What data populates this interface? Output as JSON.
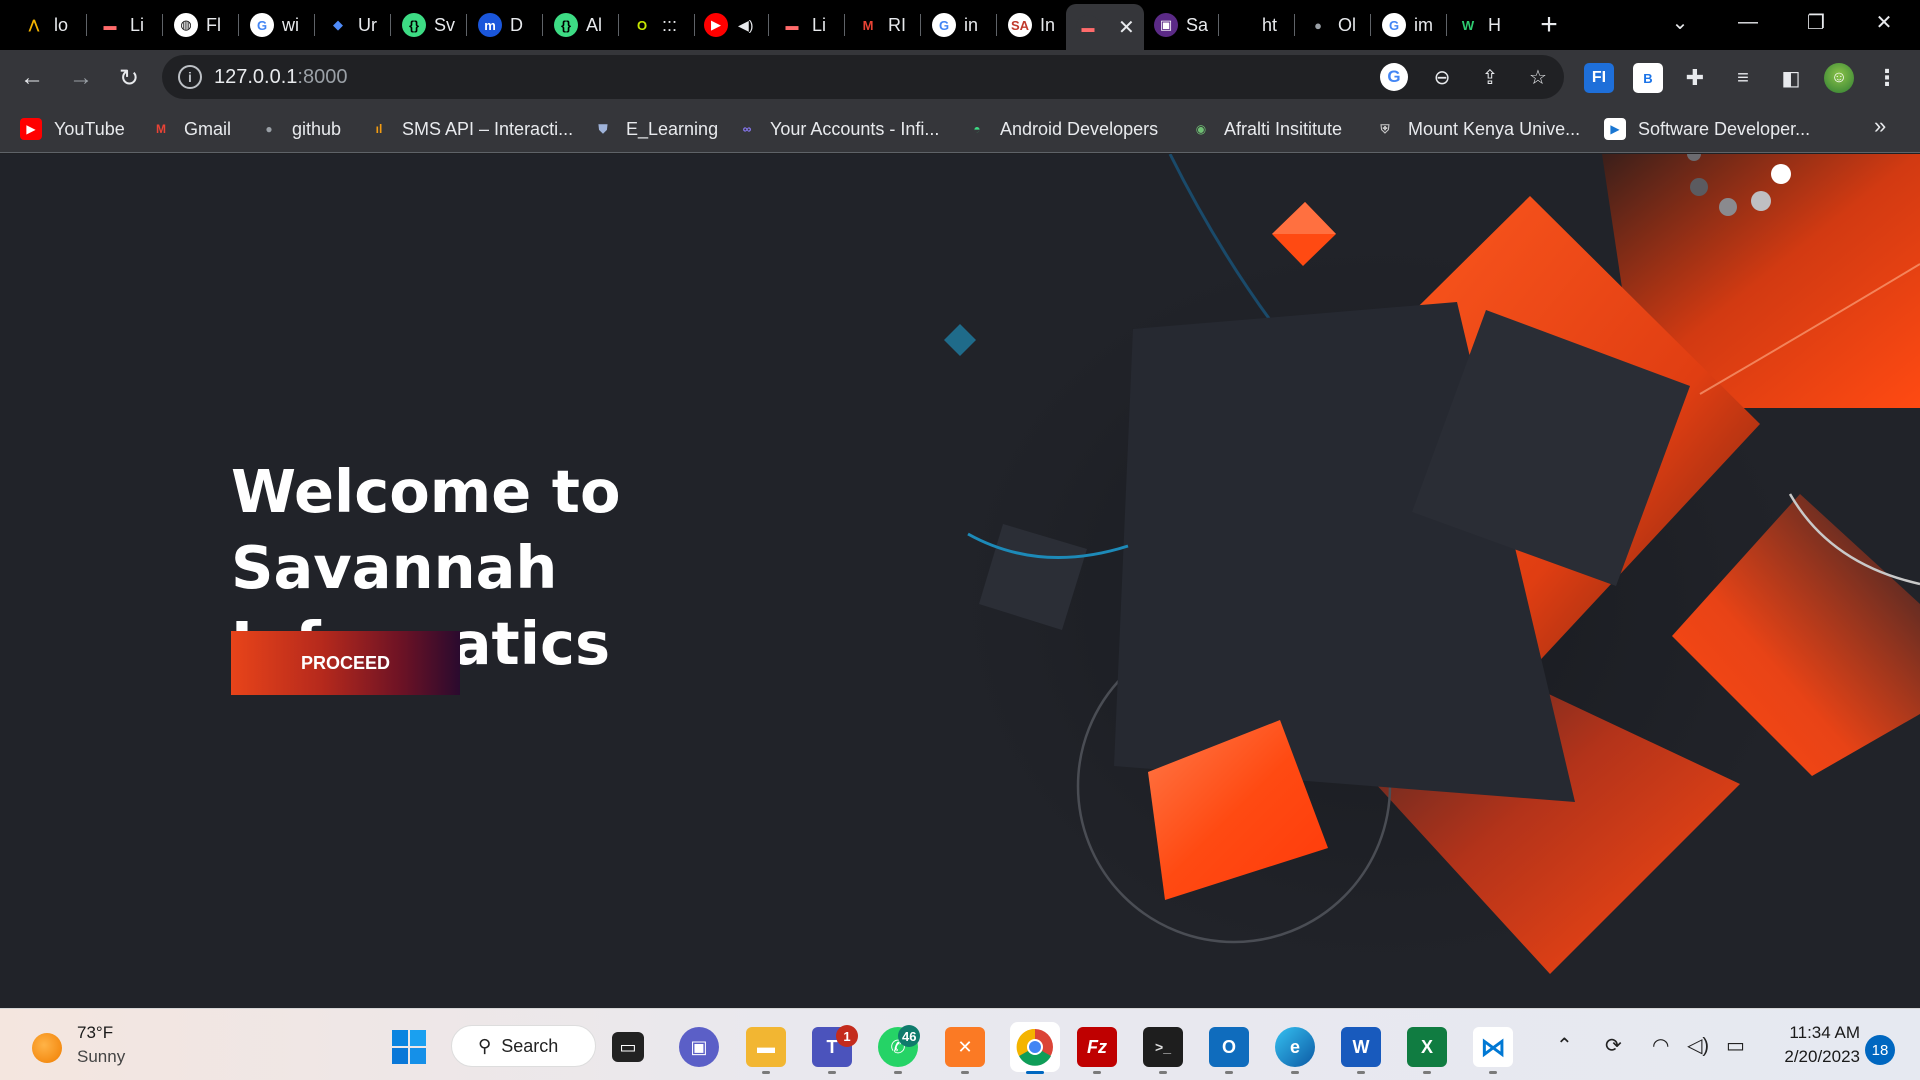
{
  "tabs": [
    {
      "title": "lo",
      "icon": "archway-logo-icon",
      "fav_bg": "#000000",
      "fav_fg": "#f4b400",
      "fav_char": "⋀"
    },
    {
      "title": "Li",
      "icon": "red-dash-icon",
      "fav_bg": "#000000",
      "fav_fg": "#ff6b6b",
      "fav_char": "▬"
    },
    {
      "title": "Fl",
      "icon": "globe-icon",
      "fav_bg": "#ffffff",
      "fav_fg": "#000000",
      "fav_char": "◍"
    },
    {
      "title": "wi",
      "icon": "google-icon",
      "fav_bg": "#ffffff",
      "fav_fg": "#4285f4",
      "fav_char": "G"
    },
    {
      "title": "Ur",
      "icon": "blue-diamond-icon",
      "fav_bg": "#000000",
      "fav_fg": "#4f8bf9",
      "fav_char": "◆"
    },
    {
      "title": "Sv",
      "icon": "green-code-icon",
      "fav_bg": "#3ddc84",
      "fav_fg": "#000000",
      "fav_char": "{}"
    },
    {
      "title": "D",
      "icon": "m-logo-icon",
      "fav_bg": "#1a56db",
      "fav_fg": "#ffffff",
      "fav_char": "m"
    },
    {
      "title": "Al",
      "icon": "green-code-icon",
      "fav_bg": "#3ddc84",
      "fav_fg": "#000000",
      "fav_char": "{}"
    },
    {
      "title": ":::",
      "icon": "olympic-ring-icon",
      "fav_bg": "#000000",
      "fav_fg": "#c6e600",
      "fav_char": "O"
    },
    {
      "title": "",
      "icon": "youtube-icon",
      "fav_bg": "#ff0000",
      "fav_fg": "#ffffff",
      "fav_char": "▶"
    },
    {
      "title": "Li",
      "icon": "red-dash-icon",
      "fav_bg": "#000000",
      "fav_fg": "#ff6b6b",
      "fav_char": "▬"
    },
    {
      "title": "RI",
      "icon": "gmail-icon",
      "fav_bg": "#000000",
      "fav_fg": "#ea4335",
      "fav_char": "M"
    },
    {
      "title": "in",
      "icon": "google-icon",
      "fav_bg": "#ffffff",
      "fav_fg": "#4285f4",
      "fav_char": "G"
    },
    {
      "title": "In",
      "icon": "sa-logo-icon",
      "fav_bg": "#ffffff",
      "fav_fg": "#c0392b",
      "fav_char": "SA"
    },
    {
      "title": "",
      "icon": "red-dash-icon",
      "fav_bg": "#35363a",
      "fav_fg": "#ff6b6b",
      "fav_char": "▬",
      "active": true
    },
    {
      "title": "Sa",
      "icon": "purple-app-icon",
      "fav_bg": "#5b2a86",
      "fav_fg": "#ffffff",
      "fav_char": "▣"
    },
    {
      "title": "ht",
      "icon": "blank-page-icon",
      "fav_bg": "#000000",
      "fav_fg": "#000000",
      "fav_char": ""
    },
    {
      "title": "Ol",
      "icon": "github-icon",
      "fav_bg": "#000000",
      "fav_fg": "#9aa0a6",
      "fav_char": "●"
    },
    {
      "title": "im",
      "icon": "google-icon",
      "fav_bg": "#ffffff",
      "fav_fg": "#4285f4",
      "fav_char": "G"
    },
    {
      "title": "H",
      "icon": "w-logo-icon",
      "fav_bg": "#000000",
      "fav_fg": "#2ecc71",
      "fav_char": "W"
    }
  ],
  "toolbar": {
    "url_host": "127.0.0.1",
    "url_port": ":8000"
  },
  "bookmarks": [
    {
      "label": "YouTube",
      "icon": "youtube-icon",
      "bg": "#ff0000",
      "fg": "#ffffff",
      "char": "▶"
    },
    {
      "label": "Gmail",
      "icon": "gmail-icon",
      "bg": "transparent",
      "fg": "#ea4335",
      "char": "M"
    },
    {
      "label": "github",
      "icon": "github-icon",
      "bg": "transparent",
      "fg": "#9aa0a6",
      "char": "●"
    },
    {
      "label": "SMS API – Interacti...",
      "icon": "sms-api-icon",
      "bg": "transparent",
      "fg": "#f39c12",
      "char": "ıl"
    },
    {
      "label": "E_Learning",
      "icon": "shield-crest-icon",
      "bg": "transparent",
      "fg": "#9fb3d9",
      "char": "⛊"
    },
    {
      "label": "Your Accounts - Infi...",
      "icon": "infinity-icon",
      "bg": "transparent",
      "fg": "#8e7cff",
      "char": "∞"
    },
    {
      "label": "Android Developers",
      "icon": "android-icon",
      "bg": "transparent",
      "fg": "#3ddc84",
      "char": "◓"
    },
    {
      "label": "Afralti Insititute",
      "icon": "afralti-logo-icon",
      "bg": "transparent",
      "fg": "#6fbf73",
      "char": "◉"
    },
    {
      "label": "Mount Kenya Unive...",
      "icon": "university-crest-icon",
      "bg": "transparent",
      "fg": "#c7c7c7",
      "char": "⛨"
    },
    {
      "label": "Software Developer...",
      "icon": "play-square-icon",
      "bg": "#ffffff",
      "fg": "#1976d2",
      "char": "▶"
    }
  ],
  "hero": {
    "title": "Welcome to Savannah Informatics",
    "button_label": "PROCEED"
  },
  "taskbar": {
    "weather_temp": "73°F",
    "weather_cond": "Sunny",
    "search_label": "Search",
    "teams_badge": "1",
    "whatsapp_badge": "46",
    "time": "11:34 AM",
    "date": "2/20/2023",
    "notifications": "18"
  },
  "colors": {
    "accent_orange": "#ff4a12",
    "page_bg": "#212329",
    "shape_dark": "#262931"
  }
}
